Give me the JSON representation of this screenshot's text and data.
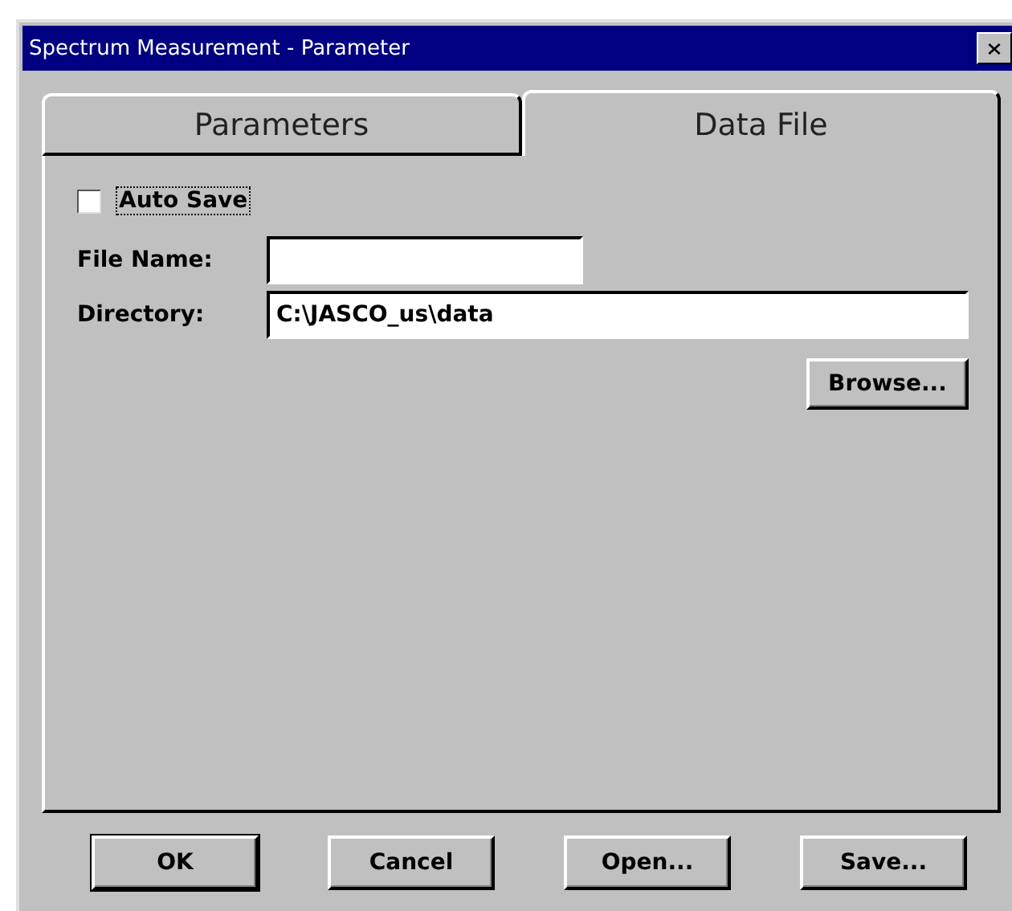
{
  "window": {
    "title": "Spectrum Measurement - Parameter"
  },
  "tabs": [
    {
      "label": "Parameters",
      "selected": false
    },
    {
      "label": "Data File",
      "selected": true
    }
  ],
  "auto_save": {
    "label": "Auto Save",
    "checked": false
  },
  "file_name": {
    "label": "File Name:"
  },
  "directory": {
    "label": "Directory:",
    "value": "C:\\JASCO_us\\data"
  },
  "browse_button": "Browse...",
  "buttons": [
    {
      "label": "OK",
      "default": true
    },
    {
      "label": "Cancel",
      "default": false
    },
    {
      "label": "Open...",
      "default": false
    },
    {
      "label": "Save...",
      "default": false
    }
  ]
}
